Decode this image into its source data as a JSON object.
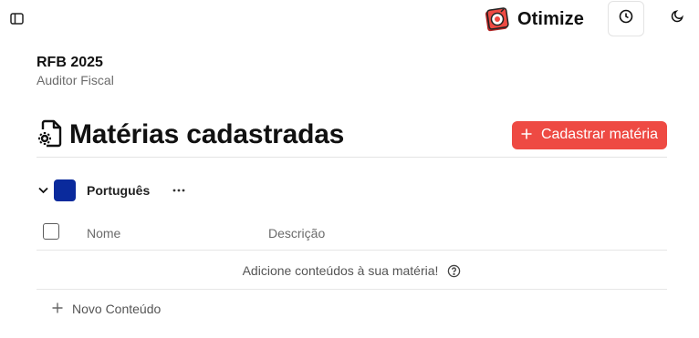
{
  "brand": {
    "name": "Otimize"
  },
  "exam": {
    "title": "RFB 2025",
    "subtitle": "Auditor Fiscal"
  },
  "section": {
    "title": "Matérias cadastradas",
    "add_button_label": "Cadastrar matéria",
    "add_button_icon": "plus-icon",
    "title_icon": "file-gear-icon"
  },
  "subject": {
    "name": "Português",
    "color": "#0a2a9c",
    "expanded": true
  },
  "table": {
    "columns": [
      "Nome",
      "Descrição"
    ],
    "empty_message": "Adicione conteúdos à sua matéria!"
  },
  "new_content": {
    "label": "Novo Conteúdo"
  },
  "colors": {
    "accent": "#ee4a43",
    "subject": "#0a2a9c"
  },
  "icons": {
    "sidebar_toggle": "sidebar-panel-icon",
    "history": "clock-icon",
    "theme": "moon-icon",
    "help": "question-circle-icon",
    "more": "ellipsis-icon",
    "chevron": "chevron-down-icon"
  }
}
